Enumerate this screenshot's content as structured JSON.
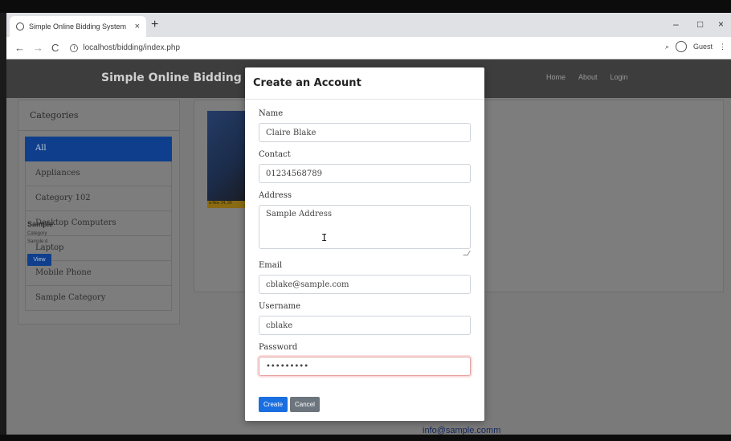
{
  "browser": {
    "tab_title": "Simple Online Bidding System",
    "tab_close": "×",
    "new_tab": "+",
    "minimize": "–",
    "maximize": "□",
    "close": "×",
    "url": "localhost/bidding/index.php",
    "profile_label": "Guest",
    "menu": "⋮"
  },
  "navbar": {
    "brand": "Simple Online Bidding System",
    "links": [
      "Home",
      "About",
      "Login"
    ]
  },
  "sidebar": {
    "title": "Categories",
    "items": [
      "All",
      "Appliances",
      "Category 102",
      "Desktop Computers",
      "Laptop",
      "Mobile Phone",
      "Sample Category"
    ]
  },
  "product": {
    "badge": "● Nov 14, 20",
    "name": "Sample",
    "category": "Category",
    "desc": "Sample d",
    "view_label": "View"
  },
  "footer": {
    "email": "info@sample.comm"
  },
  "modal": {
    "title": "Create an Account",
    "fields": {
      "name_label": "Name",
      "name_value": "Claire Blake",
      "contact_label": "Contact",
      "contact_value": "01234568789",
      "address_label": "Address",
      "address_value": "Sample Address",
      "email_label": "Email",
      "email_value": "cblake@sample.com",
      "username_label": "Username",
      "username_value": "cblake",
      "password_label": "Password",
      "password_value": "•••••••••"
    },
    "create_label": "Create",
    "cancel_label": "Cancel"
  },
  "colors": {
    "primary": "#1a6fe0",
    "secondary": "#6c757d",
    "navbar": "#3d3d3d",
    "active_category": "#0f3f8c"
  }
}
